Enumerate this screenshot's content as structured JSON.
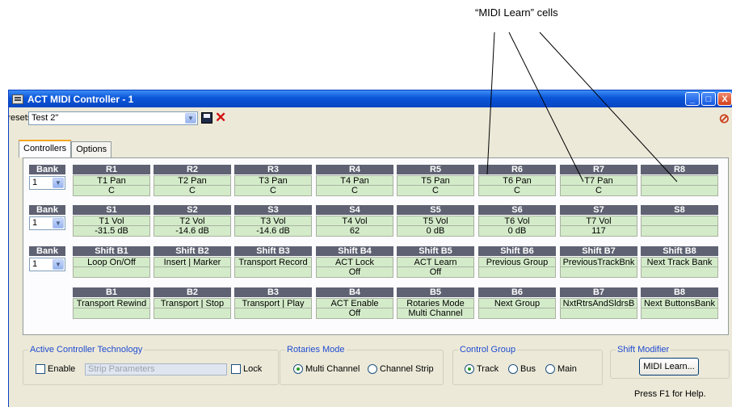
{
  "annotation": {
    "text": "“MIDI Learn” cells"
  },
  "window": {
    "title": "ACT MIDI Controller - 1",
    "buttons": {
      "minimize": "_",
      "maximize": "□",
      "close": "X"
    }
  },
  "presets": {
    "label": "Presets:",
    "value": "Test 2\""
  },
  "tabs": [
    "Controllers",
    "Options"
  ],
  "bank_label": "Bank",
  "banks": [
    "1",
    "1",
    "1"
  ],
  "rows": [
    [
      {
        "h": "R1",
        "a": "T1 Pan",
        "b": "C"
      },
      {
        "h": "R2",
        "a": "T2 Pan",
        "b": "C"
      },
      {
        "h": "R3",
        "a": "T3 Pan",
        "b": "C"
      },
      {
        "h": "R4",
        "a": "T4 Pan",
        "b": "C"
      },
      {
        "h": "R5",
        "a": "T5 Pan",
        "b": "C"
      },
      {
        "h": "R6",
        "a": "T6 Pan",
        "b": "C"
      },
      {
        "h": "R7",
        "a": "T7 Pan",
        "b": "C"
      },
      {
        "h": "R8",
        "a": "",
        "b": ""
      }
    ],
    [
      {
        "h": "S1",
        "a": "T1 Vol",
        "b": "-31.5  dB"
      },
      {
        "h": "S2",
        "a": "T2 Vol",
        "b": "-14.6  dB"
      },
      {
        "h": "S3",
        "a": "T3 Vol",
        "b": "-14.6  dB"
      },
      {
        "h": "S4",
        "a": "T4 Vol",
        "b": "62"
      },
      {
        "h": "S5",
        "a": "T5 Vol",
        "b": "0  dB"
      },
      {
        "h": "S6",
        "a": "T6 Vol",
        "b": "0  dB"
      },
      {
        "h": "S7",
        "a": "T7 Vol",
        "b": "117"
      },
      {
        "h": "S8",
        "a": "",
        "b": ""
      }
    ],
    [
      {
        "h": "Shift B1",
        "a": "Loop On/Off",
        "b": ""
      },
      {
        "h": "Shift B2",
        "a": "Insert | Marker",
        "b": ""
      },
      {
        "h": "Shift B3",
        "a": "Transport Record",
        "b": ""
      },
      {
        "h": "Shift B4",
        "a": "ACT Lock",
        "b": "Off"
      },
      {
        "h": "Shift B5",
        "a": "ACT Learn",
        "b": "Off"
      },
      {
        "h": "Shift B6",
        "a": "Previous Group",
        "b": ""
      },
      {
        "h": "Shift B7",
        "a": "PreviousTrackBnk",
        "b": ""
      },
      {
        "h": "Shift B8",
        "a": "Next Track Bank",
        "b": ""
      }
    ],
    [
      {
        "h": "B1",
        "a": "Transport Rewind",
        "b": ""
      },
      {
        "h": "B2",
        "a": "Transport | Stop",
        "b": ""
      },
      {
        "h": "B3",
        "a": "Transport | Play",
        "b": ""
      },
      {
        "h": "B4",
        "a": "ACT Enable",
        "b": "Off"
      },
      {
        "h": "B5",
        "a": "Rotaries Mode",
        "b": "Multi Channel"
      },
      {
        "h": "B6",
        "a": "Next Group",
        "b": ""
      },
      {
        "h": "B7",
        "a": "NxtRtrsAndSldrsB",
        "b": ""
      },
      {
        "h": "B8",
        "a": "Next ButtonsBank",
        "b": ""
      }
    ]
  ],
  "act_group": {
    "title": "Active Controller Technology",
    "enable": "Enable",
    "strip": "Strip Parameters",
    "lock": "Lock"
  },
  "rotaries_group": {
    "title": "Rotaries Mode",
    "options": [
      "Multi Channel",
      "Channel Strip"
    ],
    "selected": "Multi Channel"
  },
  "control_group": {
    "title": "Control Group",
    "options": [
      "Track",
      "Bus",
      "Main"
    ],
    "selected": "Track"
  },
  "shift_group": {
    "title": "Shift Modifier",
    "button": "MIDI Learn..."
  },
  "help_text": "Press F1 for Help."
}
